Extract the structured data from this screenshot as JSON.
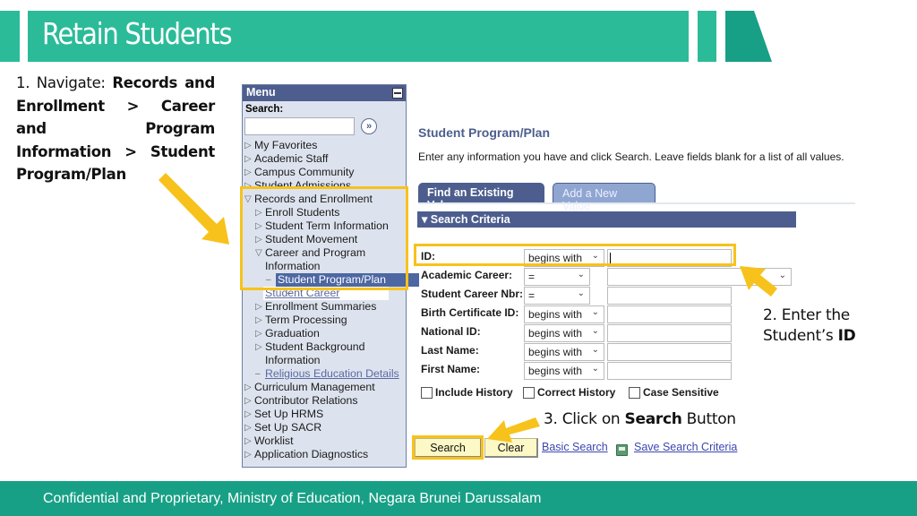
{
  "slide": {
    "title": "Retain Students",
    "footer": "Confidential and Proprietary, Ministry of Education, Negara Brunei Darussalam",
    "colors": {
      "header": "#2bbb98",
      "header_dark": "#18a086",
      "highlight": "#f7c21b",
      "ps_blue": "#4d5e8e"
    }
  },
  "instructions": {
    "step1_prefix": "1. Navigate: ",
    "step1_bold": "Records and Enrollment > Career and Program Information > Student Program/Plan",
    "step2_line1": "2. Enter the",
    "step2_line2_prefix": "Student’s ",
    "step2_line2_bold": "ID",
    "step3_prefix": "3. Click on ",
    "step3_bold": "Search",
    "step3_suffix": " Button"
  },
  "menu": {
    "title": "Menu",
    "search_label": "Search:",
    "search_value": "",
    "go_glyph": "»",
    "items": [
      {
        "label": "My Favorites",
        "level": 0,
        "icon": "triangle-right"
      },
      {
        "label": "Academic Staff",
        "level": 0,
        "icon": "triangle-right"
      },
      {
        "label": "Campus Community",
        "level": 0,
        "icon": "triangle-right"
      },
      {
        "label": "Student Admissions",
        "level": 0,
        "icon": "triangle-right"
      },
      {
        "label": "Records and Enrollment",
        "level": 0,
        "icon": "triangle-down"
      },
      {
        "label": "Enroll Students",
        "level": 1,
        "icon": "triangle-right"
      },
      {
        "label": "Student Term Information",
        "level": 1,
        "icon": "triangle-right"
      },
      {
        "label": "Student Movement",
        "level": 1,
        "icon": "triangle-right"
      },
      {
        "label": "Career and Program",
        "level": 1,
        "icon": "triangle-down"
      },
      {
        "label": "Information",
        "level": 1,
        "icon": "none"
      },
      {
        "label": "Student Program/Plan",
        "level": 2,
        "icon": "dash",
        "selected": true
      },
      {
        "label": "Student Career",
        "level": 2,
        "icon": "dash",
        "link": true
      },
      {
        "label": "Enrollment Summaries",
        "level": 1,
        "icon": "triangle-right"
      },
      {
        "label": "Term Processing",
        "level": 1,
        "icon": "triangle-right"
      },
      {
        "label": "Graduation",
        "level": 1,
        "icon": "triangle-right"
      },
      {
        "label": "Student Background",
        "level": 1,
        "icon": "triangle-right"
      },
      {
        "label": "Information",
        "level": 1,
        "icon": "none"
      },
      {
        "label": "Religious Education Details",
        "level": 1,
        "icon": "dash",
        "link": true
      },
      {
        "label": "Curriculum Management",
        "level": 0,
        "icon": "triangle-right"
      },
      {
        "label": "Contributor Relations",
        "level": 0,
        "icon": "triangle-right"
      },
      {
        "label": "Set Up HRMS",
        "level": 0,
        "icon": "triangle-right"
      },
      {
        "label": "Set Up SACR",
        "level": 0,
        "icon": "triangle-right"
      },
      {
        "label": "Worklist",
        "level": 0,
        "icon": "triangle-right"
      },
      {
        "label": "Application Diagnostics",
        "level": 0,
        "icon": "triangle-right"
      }
    ]
  },
  "page": {
    "title": "Student Program/Plan",
    "instruction": "Enter any information you have and click Search. Leave fields blank for a list of all values.",
    "tabs": [
      {
        "label": "Find an Existing Value",
        "active": true
      },
      {
        "label": "Add a New Value",
        "active": false
      }
    ],
    "section_title": "Search Criteria",
    "fields": [
      {
        "label": "ID:",
        "operator": "begins with",
        "value": ""
      },
      {
        "label": "Academic Career:",
        "operator": "=",
        "value": ""
      },
      {
        "label": "Student Career Nbr:",
        "operator": "=",
        "value": ""
      },
      {
        "label": "Birth Certificate ID:",
        "operator": "begins with",
        "value": ""
      },
      {
        "label": "National ID:",
        "operator": "begins with",
        "value": ""
      },
      {
        "label": "Last Name:",
        "operator": "begins with",
        "value": ""
      },
      {
        "label": "First Name:",
        "operator": "begins with",
        "value": ""
      }
    ],
    "checkboxes": [
      {
        "label": "Include History",
        "checked": false
      },
      {
        "label": "Correct History",
        "checked": false
      },
      {
        "label": "Case Sensitive",
        "checked": false
      }
    ],
    "buttons": {
      "search": "Search",
      "clear": "Clear"
    },
    "links": {
      "basic_search": "Basic Search",
      "save_criteria": "Save Search Criteria"
    }
  }
}
